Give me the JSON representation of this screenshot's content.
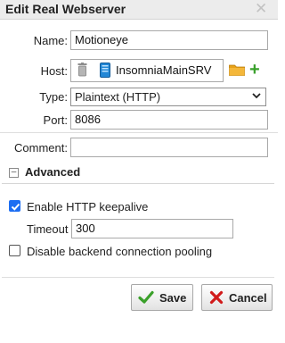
{
  "dialog": {
    "title": "Edit Real Webserver",
    "close_icon": "close-icon"
  },
  "form": {
    "name_label": "Name:",
    "name_value": "Motioneye",
    "host_label": "Host:",
    "host_value": "InsomniaMainSRV",
    "host_icons": [
      "trash-icon",
      "server-icon",
      "folder-icon",
      "plus-icon"
    ],
    "type_label": "Type:",
    "type_selected": "Plaintext (HTTP)",
    "port_label": "Port:",
    "port_value": "8086",
    "comment_label": "Comment:",
    "comment_value": ""
  },
  "advanced": {
    "title": "Advanced",
    "keepalive_label": "Enable HTTP keepalive",
    "keepalive_checked": true,
    "timeout_label": "Timeout",
    "timeout_value": "300",
    "pooling_label": "Disable backend connection pooling",
    "pooling_checked": false
  },
  "buttons": {
    "save_label": "Save",
    "cancel_label": "Cancel"
  },
  "colors": {
    "accent_blue": "#1d6ef2",
    "save_check": "#3aa02a",
    "cancel_x": "#d11a1a",
    "folder": "#e8a117",
    "plus": "#39a02b"
  }
}
